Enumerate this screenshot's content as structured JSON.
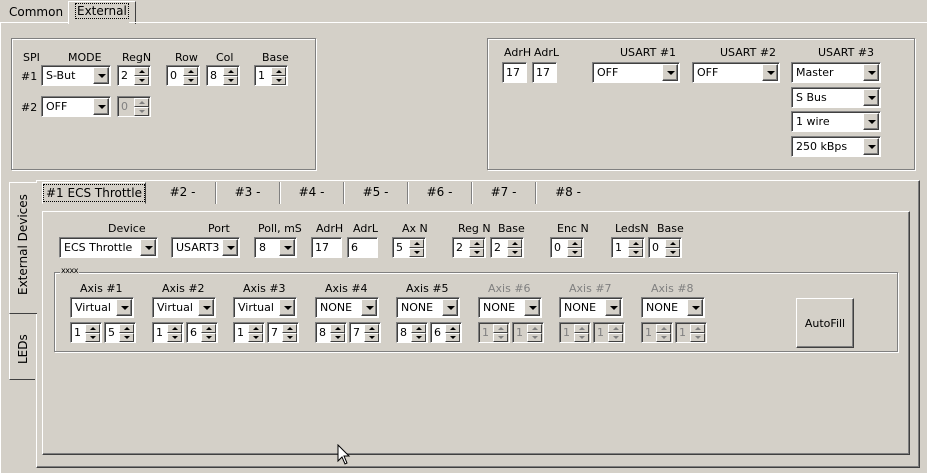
{
  "tabs": {
    "common": "Common",
    "external": "External"
  },
  "spi": {
    "labels": {
      "spi": "SPI",
      "mode": "MODE",
      "regn": "RegN",
      "row": "Row",
      "col": "Col",
      "base": "Base",
      "row1": "#1",
      "row2": "#2"
    },
    "r1": {
      "mode": "S-But",
      "regn": "2",
      "row": "0",
      "col": "8",
      "base": "1"
    },
    "r2": {
      "mode": "OFF",
      "regn": "0"
    }
  },
  "usart": {
    "labels": {
      "adrh": "AdrH",
      "adrl": "AdrL",
      "u1": "USART #1",
      "u2": "USART #2",
      "u3": "USART #3"
    },
    "adrh": "17",
    "adrl": "17",
    "u1": "OFF",
    "u2": "OFF",
    "u3": [
      "Master",
      "S Bus",
      "1 wire",
      "250 kBps"
    ]
  },
  "sidetabs": {
    "external": "External Devices",
    "leds": "LEDs"
  },
  "devtabs": [
    "#1 ECS Throttle",
    "#2 -",
    "#3 -",
    "#4 -",
    "#5 -",
    "#6 -",
    "#7 -",
    "#8 -"
  ],
  "device": {
    "labels": {
      "device": "Device",
      "port": "Port",
      "poll": "Poll, mS",
      "adrh": "AdrH",
      "adrl": "AdrL",
      "axn": "Ax N",
      "regn": "Reg N",
      "base": "Base",
      "encn": "Enc N",
      "ledsn": "LedsN",
      "base2": "Base"
    },
    "device": "ECS Throttle",
    "port": "USART3",
    "poll": "8",
    "adrh": "17",
    "adrl": "6",
    "axn": "5",
    "regn": "2",
    "base": "2",
    "encn": "0",
    "ledsn": "1",
    "base2": "0"
  },
  "axes": {
    "group_title": "xxxx",
    "items": [
      {
        "label": "Axis #1",
        "type": "Virtual",
        "a": "1",
        "b": "5"
      },
      {
        "label": "Axis #2",
        "type": "Virtual",
        "a": "1",
        "b": "6"
      },
      {
        "label": "Axis #3",
        "type": "Virtual",
        "a": "1",
        "b": "7"
      },
      {
        "label": "Axis #4",
        "type": "NONE",
        "a": "8",
        "b": "7"
      },
      {
        "label": "Axis #5",
        "type": "NONE",
        "a": "8",
        "b": "6"
      },
      {
        "label": "Axis #6",
        "type": "NONE",
        "a": "1",
        "b": "1"
      },
      {
        "label": "Axis #7",
        "type": "NONE",
        "a": "1",
        "b": "1"
      },
      {
        "label": "Axis #8",
        "type": "NONE",
        "a": "1",
        "b": "1"
      }
    ],
    "autofill": "AutoFill"
  }
}
